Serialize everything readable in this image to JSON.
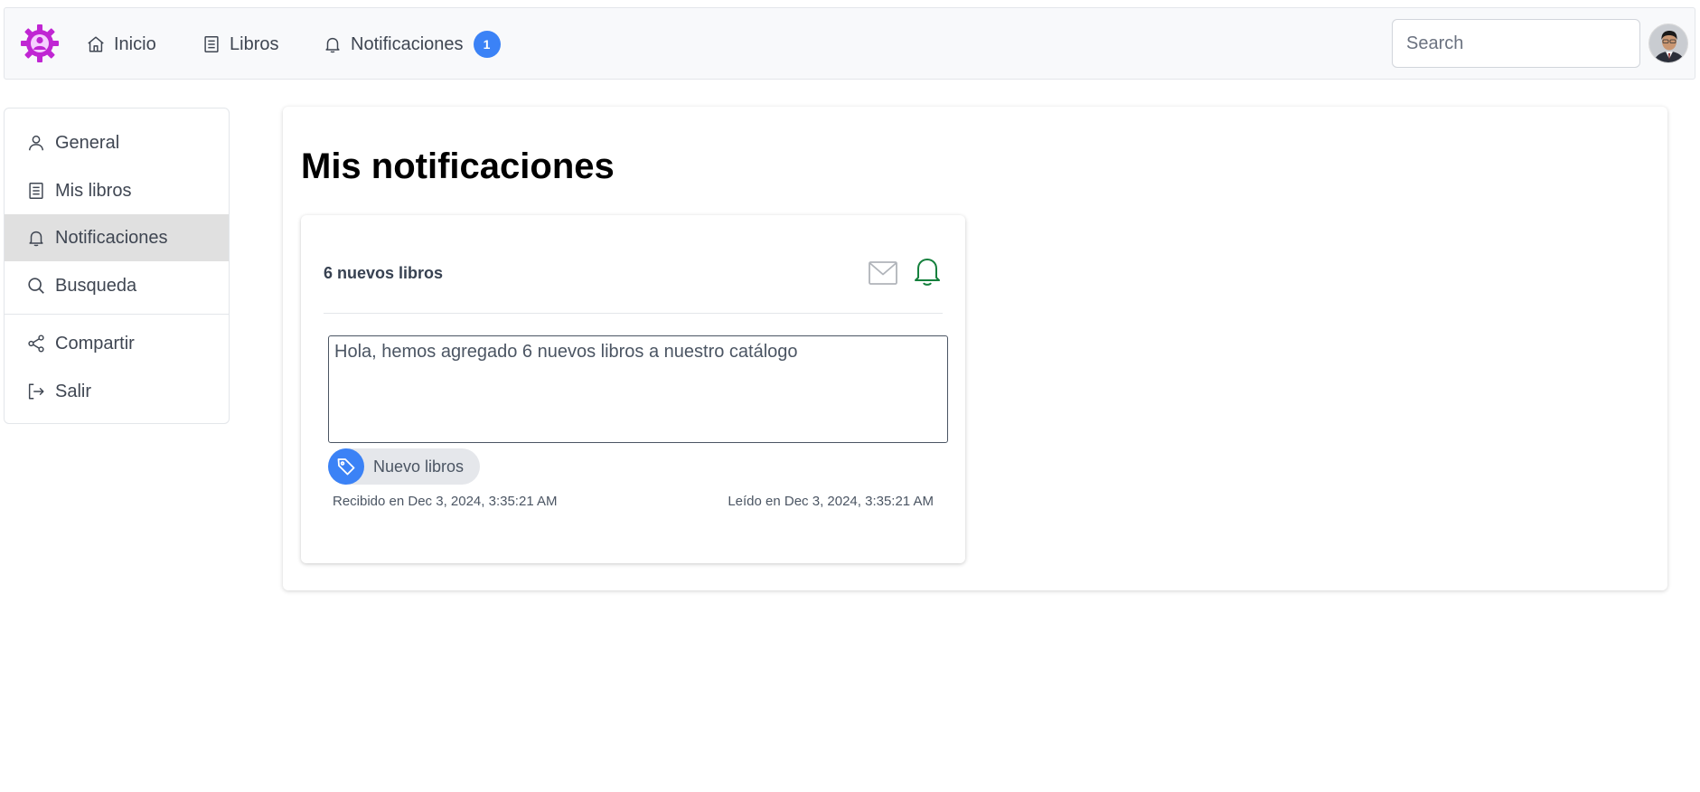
{
  "nav": {
    "items": [
      {
        "label": "Inicio",
        "icon": "home-icon"
      },
      {
        "label": "Libros",
        "icon": "book-icon"
      },
      {
        "label": "Notificaciones",
        "icon": "bell-icon",
        "badge": "1"
      }
    ],
    "search_placeholder": "Search"
  },
  "sidebar": {
    "items": [
      {
        "label": "General",
        "icon": "user-icon"
      },
      {
        "label": "Mis libros",
        "icon": "book-icon"
      },
      {
        "label": "Notificaciones",
        "icon": "bell-icon",
        "active": true
      },
      {
        "label": "Busqueda",
        "icon": "search-icon"
      },
      {
        "label": "Compartir",
        "icon": "share-icon"
      },
      {
        "label": "Salir",
        "icon": "logout-icon"
      }
    ]
  },
  "main": {
    "title": "Mis notificaciones",
    "notification": {
      "title": "6 nuevos libros",
      "message": "Hola, hemos agregado 6 nuevos libros a nuestro catálogo",
      "tag": "Nuevo libros",
      "received": "Recibido en Dec 3, 2024, 3:35:21 AM",
      "read": "Leído en Dec 3, 2024, 3:35:21 AM"
    }
  },
  "colors": {
    "accent": "#3b82f6",
    "logo": "#c026d3",
    "bell_active": "#15803d",
    "sidebar_active_bg": "#e0e0e0"
  }
}
